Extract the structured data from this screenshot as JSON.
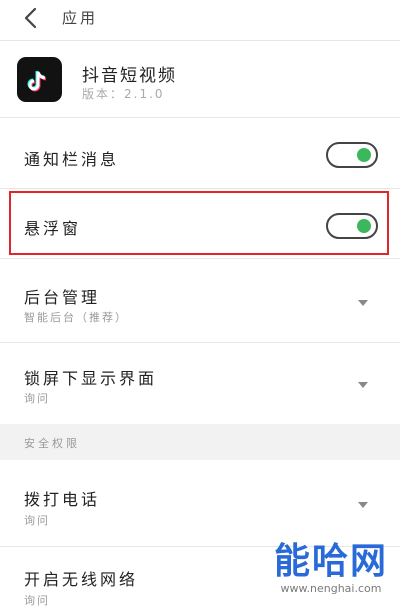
{
  "header": {
    "title": "应用"
  },
  "app": {
    "name": "抖音短视频",
    "version": "版本：2.1.0"
  },
  "settings": {
    "notification": {
      "label": "通知栏消息",
      "enabled": true
    },
    "floating_window": {
      "label": "悬浮窗",
      "enabled": true
    },
    "background": {
      "label": "后台管理",
      "value": "智能后台（推荐）"
    },
    "lockscreen": {
      "label": "锁屏下显示界面",
      "value": "询问"
    }
  },
  "security_section": {
    "title": "安全权限",
    "call": {
      "label": "拨打电话",
      "value": "询问"
    },
    "network": {
      "label": "开启无线网络",
      "value": "询问"
    }
  },
  "colors": {
    "toggle_on": "#3cb85c",
    "highlight": "#e0262b",
    "watermark": "#2a6ad8"
  },
  "watermark": {
    "main": "能哈网",
    "url": "www.nenghai.com"
  }
}
